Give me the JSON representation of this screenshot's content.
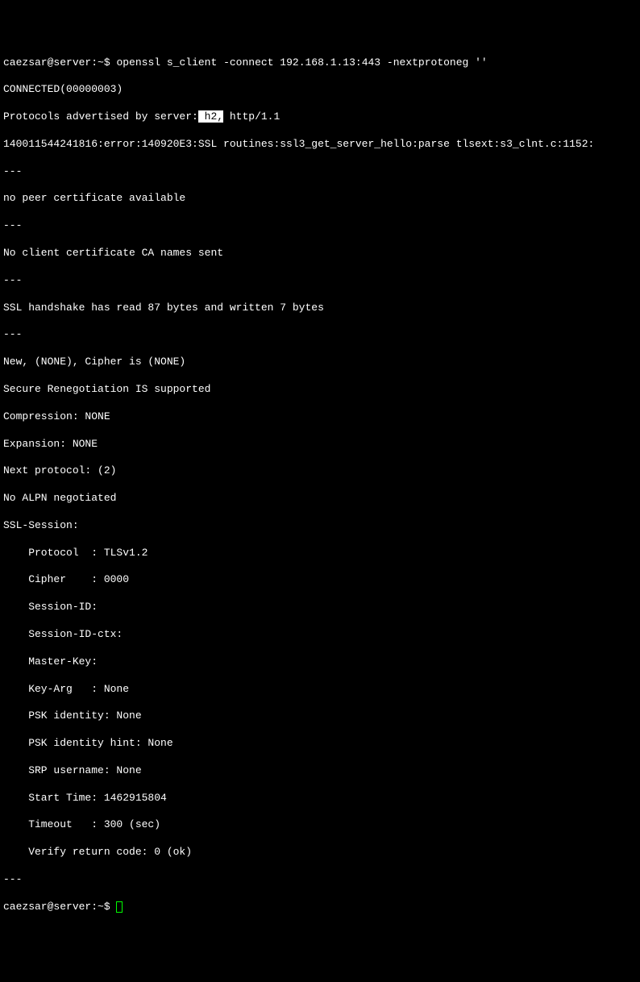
{
  "prompt1_user": "caezsar@server",
  "prompt1_sep": ":",
  "prompt1_path": "~",
  "prompt1_sym": "$",
  "command1": " openssl s_client -connect 192.168.1.13:443 -nextprotoneg ''",
  "lines": {
    "connected": "CONNECTED(00000003)",
    "proto_prefix": "Protocols advertised by server:",
    "proto_highlight": " h2,",
    "proto_suffix": " http/1.1",
    "error": "140011544241816:error:140920E3:SSL routines:ssl3_get_server_hello:parse tlsext:s3_clnt.c:1152:",
    "dash1": "---",
    "nopeer": "no peer certificate available",
    "dash2": "---",
    "noclient": "No client certificate CA names sent",
    "dash3": "---",
    "handshake": "SSL handshake has read 87 bytes and written 7 bytes",
    "dash4": "---",
    "newcipher": "New, (NONE), Cipher is (NONE)",
    "secure": "Secure Renegotiation IS supported",
    "compression": "Compression: NONE",
    "expansion": "Expansion: NONE",
    "nextproto": "Next protocol: (2)",
    "noalpn": "No ALPN negotiated",
    "sslsession": "SSL-Session:",
    "protocol": "    Protocol  : TLSv1.2",
    "cipher": "    Cipher    : 0000",
    "sessionid": "    Session-ID:",
    "sessionidctx": "    Session-ID-ctx:",
    "masterkey": "    Master-Key:",
    "keyarg": "    Key-Arg   : None",
    "pskid": "    PSK identity: None",
    "pskhint": "    PSK identity hint: None",
    "srp": "    SRP username: None",
    "starttime": "    Start Time: 1462915804",
    "timeout": "    Timeout   : 300 (sec)",
    "verify": "    Verify return code: 0 (ok)",
    "dash5": "---"
  },
  "prompt2_user": "caezsar@server",
  "prompt2_sep": ":",
  "prompt2_path": "~",
  "prompt2_sym": "$ "
}
